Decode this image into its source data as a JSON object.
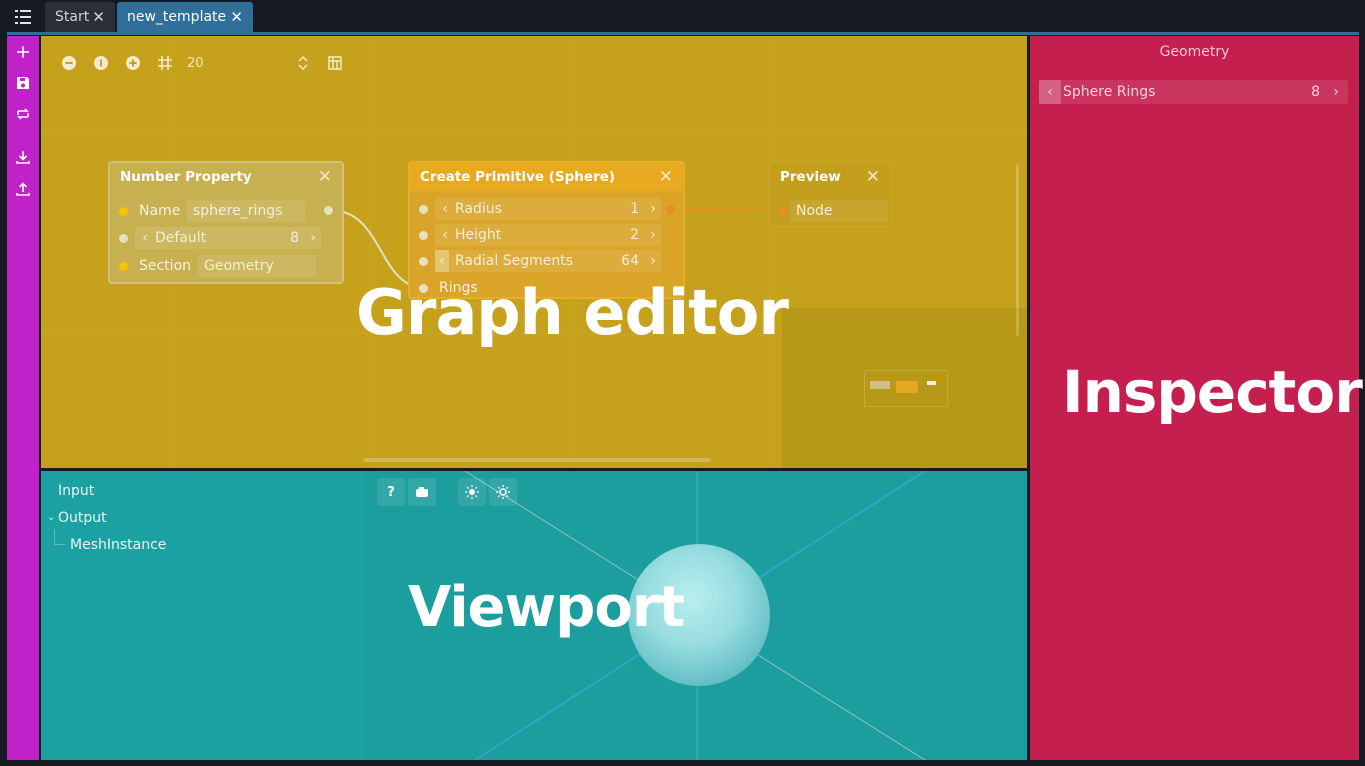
{
  "tabs": [
    {
      "label": "Start",
      "close": "✕"
    },
    {
      "label": "new_template",
      "close": "✕"
    }
  ],
  "left_toolbar": {
    "icons": [
      "add-icon",
      "save-icon",
      "sync-icon",
      "download-icon",
      "upload-icon"
    ]
  },
  "graph_editor": {
    "overlay_label": "Graph editor",
    "zoom_value": "20",
    "nodes": {
      "number_property": {
        "title": "Number Property",
        "close": "✕",
        "name_label": "Name",
        "name_value": "sphere_rings",
        "default_label": "Default",
        "default_value": "8",
        "section_label": "Section",
        "section_value": "Geometry"
      },
      "create_primitive": {
        "title": "Create Primitive (Sphere)",
        "close": "✕",
        "rows": [
          {
            "label": "Radius",
            "value": "1"
          },
          {
            "label": "Height",
            "value": "2"
          },
          {
            "label": "Radial Segments",
            "value": "64"
          }
        ],
        "rings_label": "Rings"
      },
      "preview": {
        "title": "Preview",
        "close": "✕",
        "node_label": "Node"
      }
    }
  },
  "viewport": {
    "overlay_label": "Viewport",
    "tree": [
      "Input",
      "Output",
      "MeshInstance"
    ],
    "toolbar": {
      "help": "?"
    }
  },
  "inspector": {
    "overlay_label": "Inspector",
    "section_title": "Geometry",
    "property_label": "Sphere Rings",
    "property_value": "8"
  },
  "colors": {
    "toolbar": "#c021c8",
    "graph": "#c6a11c",
    "viewport": "#1ba1a1",
    "inspector": "#c41f4e",
    "tab_active": "#2f6f9a"
  }
}
